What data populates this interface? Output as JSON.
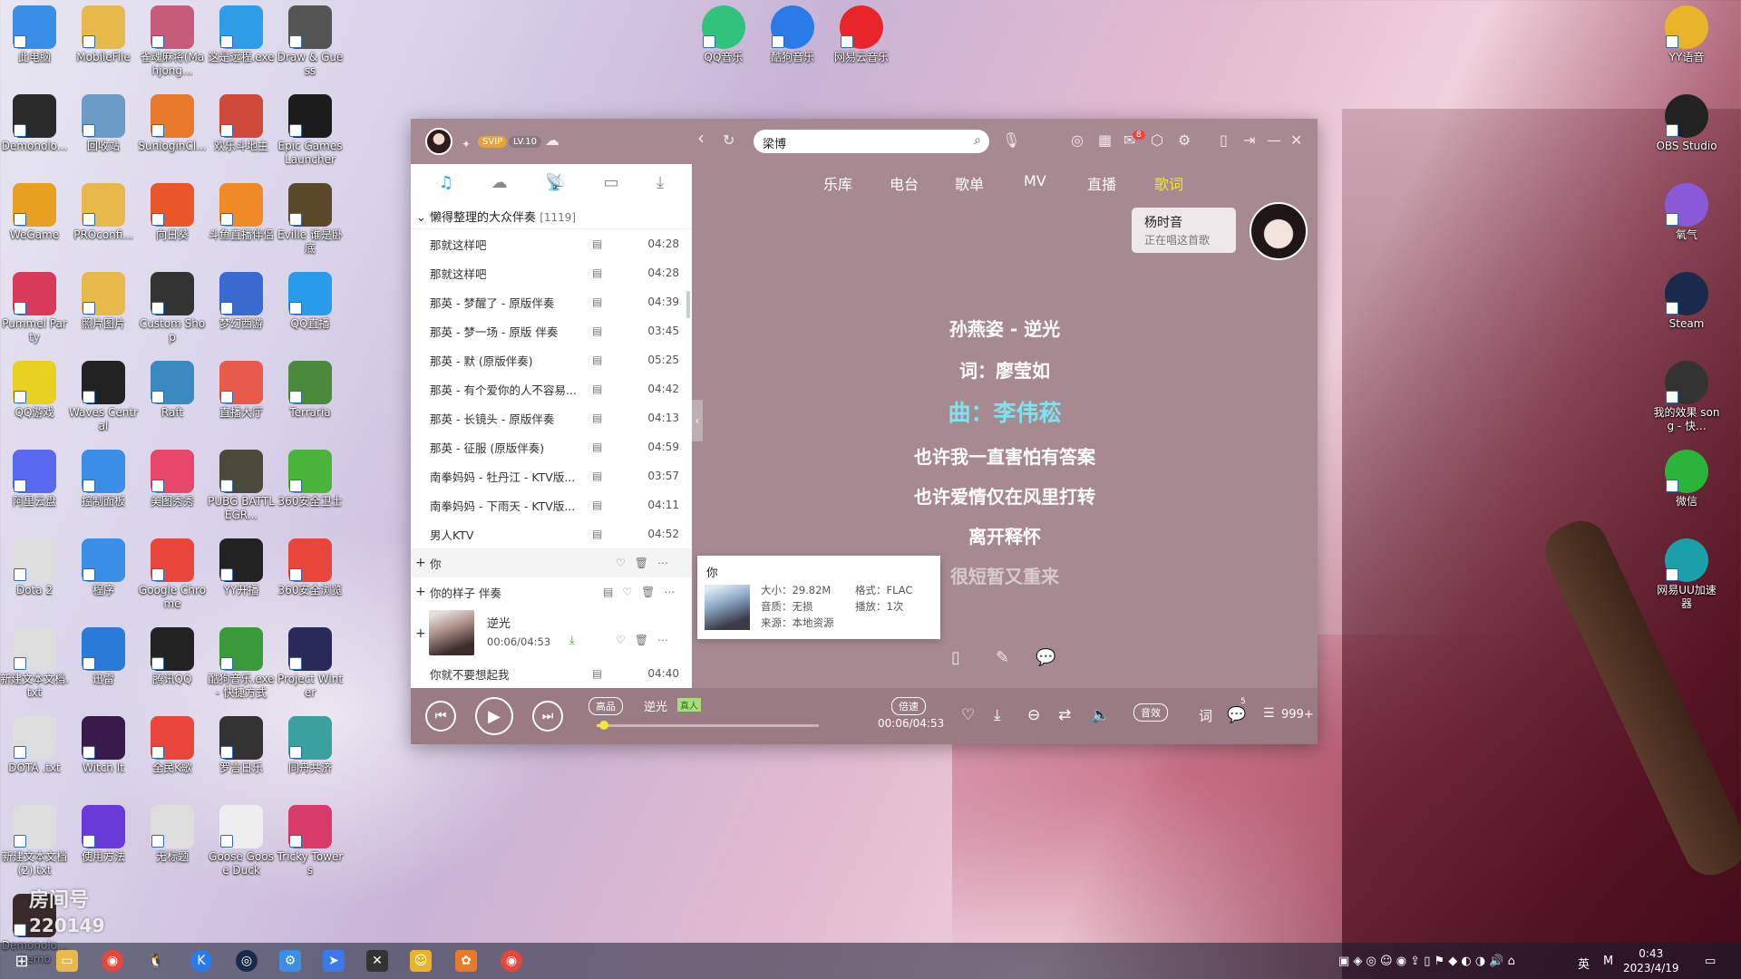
{
  "desktop": {
    "icons": [
      {
        "label": "此电脑",
        "color": "#3a8ee6"
      },
      {
        "label": "MobileFile",
        "color": "#e7b84a"
      },
      {
        "label": "雀魂麻将(Mahjong...",
        "color": "#c75c7a"
      },
      {
        "label": "这是远程.exe",
        "color": "#2e9de8"
      },
      {
        "label": "Draw & Guess",
        "color": "#555555"
      },
      {
        "label": "Demonolo...",
        "color": "#2a2a2a"
      },
      {
        "label": "回收站",
        "color": "#6d9bc7"
      },
      {
        "label": "SunloginCl...",
        "color": "#e97a2b"
      },
      {
        "label": "欢乐斗地主",
        "color": "#d04a3a"
      },
      {
        "label": "Epic Games Launcher",
        "color": "#1c1c1c"
      },
      {
        "label": "WeGame",
        "color": "#e8a020"
      },
      {
        "label": "PROconfi...",
        "color": "#e7b84a"
      },
      {
        "label": "向日葵",
        "color": "#e8562a"
      },
      {
        "label": "斗鱼直播伴侣",
        "color": "#f08a24"
      },
      {
        "label": "Eville 谁是卧底",
        "color": "#5a4a2a"
      },
      {
        "label": "Pummel Party",
        "color": "#d93a5a"
      },
      {
        "label": "照片图片",
        "color": "#e7b84a"
      },
      {
        "label": "Custom Shop",
        "color": "#333333"
      },
      {
        "label": "梦幻西游",
        "color": "#3a6ad0"
      },
      {
        "label": "QQ直播",
        "color": "#2a9be8"
      },
      {
        "label": "QQ游戏",
        "color": "#e8d020"
      },
      {
        "label": "Waves Central",
        "color": "#222222"
      },
      {
        "label": "Raft",
        "color": "#3a8abf"
      },
      {
        "label": "直播大厅",
        "color": "#e85a4a"
      },
      {
        "label": "Terraria",
        "color": "#4a8a3a"
      },
      {
        "label": "阿里云盘",
        "color": "#5a6af0"
      },
      {
        "label": "控制面板",
        "color": "#3a8ee6"
      },
      {
        "label": "美图秀秀",
        "color": "#e8466a"
      },
      {
        "label": "PUBG BATTLEGR...",
        "color": "#4a4a3a"
      },
      {
        "label": "360安全卫士",
        "color": "#4ab43a"
      },
      {
        "label": "Dota 2",
        "color": "#dddddd"
      },
      {
        "label": "程序",
        "color": "#3a8ee6"
      },
      {
        "label": "Google Chrome",
        "color": "#e8463a"
      },
      {
        "label": "YY开播",
        "color": "#222222"
      },
      {
        "label": "360安全浏览",
        "color": "#e8463a"
      },
      {
        "label": "新建文本文档.txt",
        "color": "#dddddd"
      },
      {
        "label": "迅雷",
        "color": "#2a7ad8"
      },
      {
        "label": "腾讯QQ",
        "color": "#222222"
      },
      {
        "label": "酷狗音乐.exe - 快捷方式",
        "color": "#3a9a3a"
      },
      {
        "label": "Project Winter",
        "color": "#2a2a5a"
      },
      {
        "label": "DOTA .txt",
        "color": "#dddddd"
      },
      {
        "label": "Witch It",
        "color": "#3a1a4a"
      },
      {
        "label": "全民K歌",
        "color": "#e8463a"
      },
      {
        "label": "罗言日乐",
        "color": "#333333"
      },
      {
        "label": "同舟共济",
        "color": "#3aa0a0"
      },
      {
        "label": "新建文本文档(2).txt",
        "color": "#dddddd"
      },
      {
        "label": "使用方法",
        "color": "#6a3ad8"
      },
      {
        "label": "无标题",
        "color": "#dddddd"
      },
      {
        "label": "Goose Goose Duck",
        "color": "#eeeeee"
      },
      {
        "label": "Tricky Towers",
        "color": "#d83a6a"
      },
      {
        "label": "Demonolo... Demo",
        "color": "#3a2a2a"
      }
    ],
    "top_icons": [
      {
        "label": "QQ音乐",
        "color": "#31c27c"
      },
      {
        "label": "酷狗音乐",
        "color": "#2a7ae8"
      },
      {
        "label": "网易云音乐",
        "color": "#e8262a"
      }
    ],
    "right_icons": [
      {
        "label": "YY语音",
        "color": "#e8b42a"
      },
      {
        "label": "OBS Studio",
        "color": "#222222"
      },
      {
        "label": "氧气",
        "color": "#8a5ad8"
      },
      {
        "label": "Steam",
        "color": "#1a2a4a"
      },
      {
        "label": "我的效果 song - 快...",
        "color": "#333333"
      },
      {
        "label": "微信",
        "color": "#2ab43a"
      },
      {
        "label": "网易UU加速器",
        "color": "#1aa0a8"
      }
    ],
    "room_label": "房间号",
    "room_number": "220149"
  },
  "app": {
    "svip": "SVIP",
    "level": "LV.10",
    "search_value": "梁博",
    "notification_count": "8",
    "nav_tabs": [
      {
        "label": "乐库"
      },
      {
        "label": "电台"
      },
      {
        "label": "歌单"
      },
      {
        "label": "MV"
      },
      {
        "label": "直播"
      },
      {
        "label": "歌词"
      }
    ],
    "playlist": {
      "name": "懒得整理的大众伴奏",
      "count": "[1119]",
      "songs": [
        {
          "title": "那就这样吧",
          "duration": "04:28"
        },
        {
          "title": "那就这样吧",
          "duration": "04:28"
        },
        {
          "title": "那英 - 梦醒了 - 原版伴奏",
          "duration": "04:39"
        },
        {
          "title": "那英 - 梦一场 - 原版 伴奏",
          "duration": "03:45"
        },
        {
          "title": "那英 - 默 (原版伴奏)",
          "duration": "05:25"
        },
        {
          "title": "那英 - 有个爱你的人不容易...",
          "duration": "04:42"
        },
        {
          "title": "那英 - 长镜头 - 原版伴奏",
          "duration": "04:13"
        },
        {
          "title": "那英 - 征服 (原版伴奏)",
          "duration": "04:59"
        },
        {
          "title": "南拳妈妈 - 牡丹江 - KTV版...",
          "duration": "03:57"
        },
        {
          "title": "南拳妈妈 - 下雨天 - KTV版...",
          "duration": "04:11"
        },
        {
          "title": "男人KTV",
          "duration": "04:52"
        }
      ],
      "hover_row_1": "你",
      "hover_row_2": "你的样子 伴奏",
      "now_playing_title": "逆光",
      "now_playing_time": "00:06/04:53",
      "last_row_title": "你就不要想起我",
      "last_row_duration": "04:40"
    },
    "popup": {
      "title": "你",
      "size": "大小：29.82M",
      "format": "格式：FLAC",
      "quality": "音质：无损",
      "plays": "播放：1次",
      "source": "来源：本地资源"
    },
    "singer": {
      "name": "杨时音",
      "status": "正在唱这首歌"
    },
    "lyrics": {
      "line1": "孙燕姿 - 逆光",
      "line2": "词：廖莹如",
      "line3": "曲：李伟菘",
      "line4": "也许我一直害怕有答案",
      "line5": "也许爱情仅在风里打转",
      "line6": "离开释怀",
      "line7": "很短暂又重来"
    },
    "player": {
      "quality": "高品",
      "title": "逆光",
      "vip_tag": "真人",
      "speed": "倍速",
      "time": "00:06/04:53",
      "effect": "音效",
      "lyric_btn": "词",
      "comment_count": "5",
      "list_count": "999+",
      "progress": 0.02
    }
  },
  "taskbar": {
    "ime": "英",
    "m_label": "M",
    "time": "0:43",
    "date": "2023/4/19"
  }
}
